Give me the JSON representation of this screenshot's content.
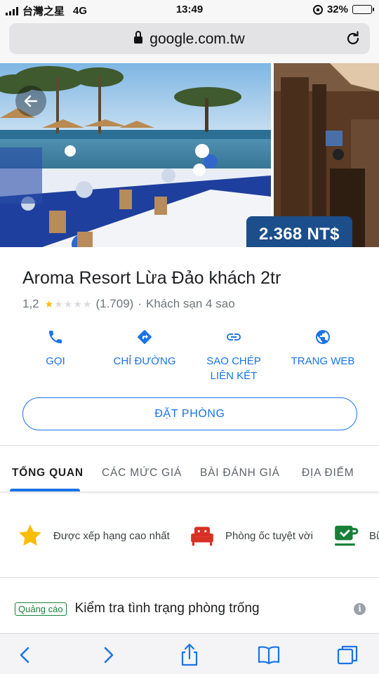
{
  "status_bar": {
    "carrier": "台灣之星",
    "network": "4G",
    "time": "13:49",
    "battery_percent_label": "32%",
    "battery_level": 0.32
  },
  "browser": {
    "url": "google.com.tw"
  },
  "hotel": {
    "price": "2.368 NT$",
    "name": "Aroma Resort Lừa Đảo khách 2tr",
    "rating": "1,2",
    "rating_stars": 1,
    "review_count": "(1.709)",
    "separator": "·",
    "category": "Khách sạn 4 sao"
  },
  "actions": {
    "call": "GỌI",
    "directions": "CHỈ ĐƯỜNG",
    "copy_link_line1": "SAO CHÉP",
    "copy_link_line2": "LIÊN KẾT",
    "website": "TRANG WEB"
  },
  "book_button": "ĐẶT PHÒNG",
  "tabs": [
    {
      "label": "TỔNG QUAN",
      "active": true
    },
    {
      "label": "CÁC MỨC GIÁ",
      "active": false
    },
    {
      "label": "BÀI ĐÁNH GIÁ",
      "active": false
    },
    {
      "label": "ĐỊA ĐIỂM",
      "active": false
    }
  ],
  "highlights": [
    {
      "icon": "star-icon",
      "label": "Được xếp hạng cao nhất"
    },
    {
      "icon": "sofa-icon",
      "label": "Phòng ốc tuyệt vời"
    },
    {
      "icon": "coffee-cup-icon",
      "label": "Bữ"
    }
  ],
  "ad": {
    "badge": "Quảng cáo",
    "title": "Kiểm tra tình trạng phòng trống"
  },
  "colors": {
    "accent": "#1a73e8",
    "price_badge": "#1b4e8a",
    "ad_green": "#188038",
    "star": "#fbbc04",
    "sofa_red": "#d93025",
    "coffee_green": "#188038"
  }
}
